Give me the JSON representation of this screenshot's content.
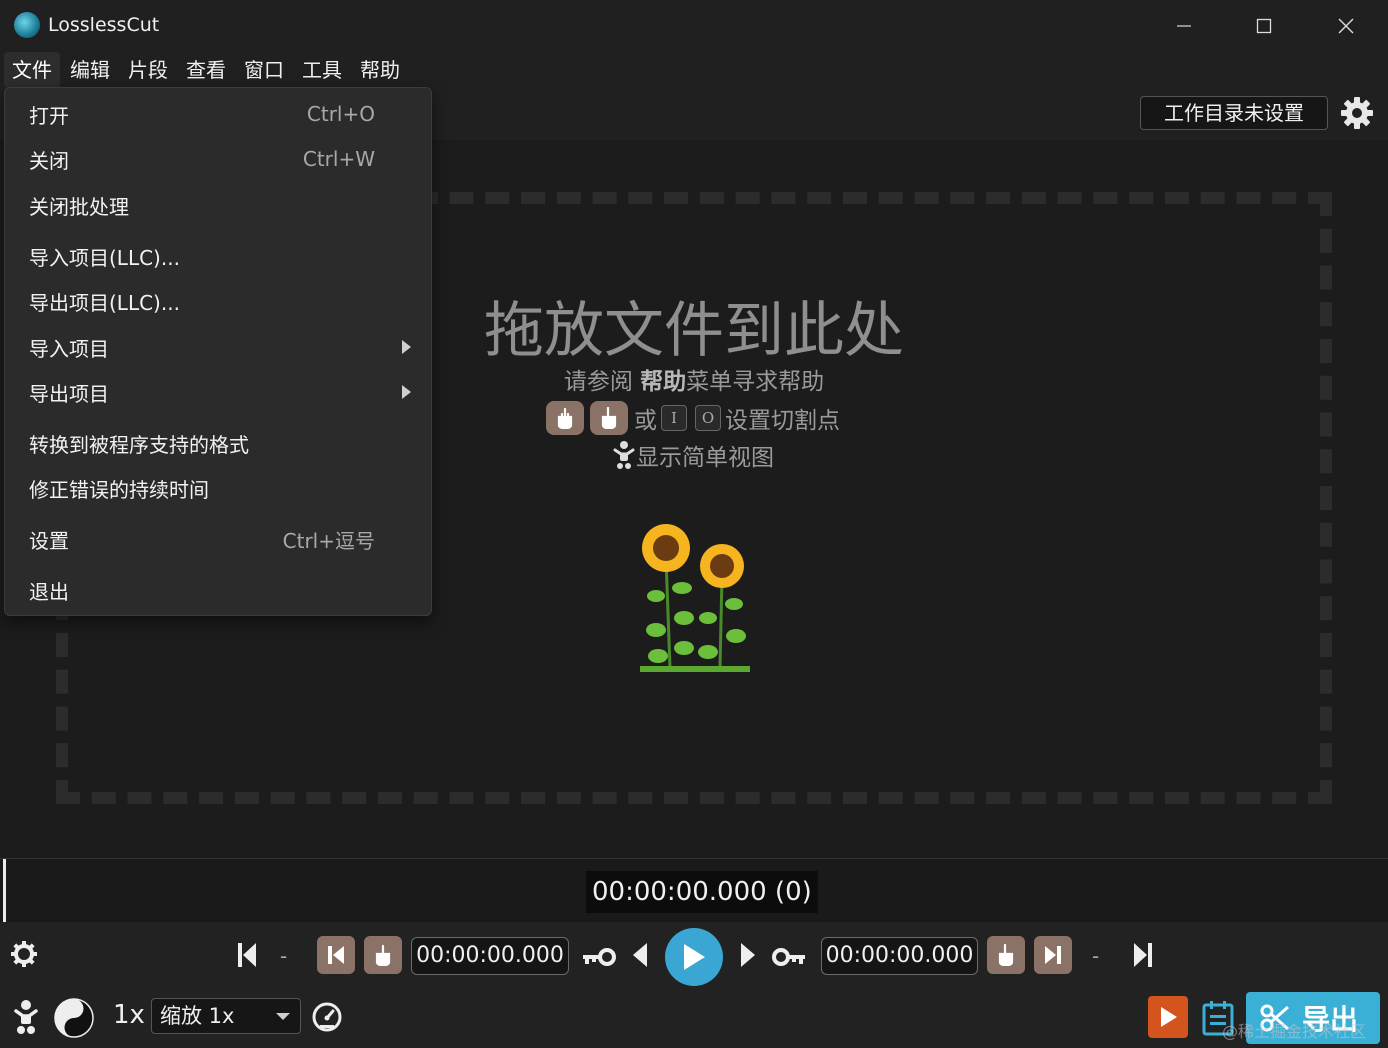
{
  "window": {
    "title": "LosslessCut"
  },
  "menubar": {
    "items": [
      "文件",
      "编辑",
      "片段",
      "查看",
      "窗口",
      "工具",
      "帮助"
    ]
  },
  "file_menu": {
    "items": [
      {
        "label": "打开",
        "shortcut": "Ctrl+O"
      },
      {
        "label": "关闭",
        "shortcut": "Ctrl+W"
      },
      {
        "label": "关闭批处理",
        "shortcut": ""
      },
      {
        "label": "导入项目(LLC)...",
        "shortcut": ""
      },
      {
        "label": "导出项目(LLC)...",
        "shortcut": ""
      },
      {
        "label": "导入项目",
        "shortcut": "",
        "submenu": true
      },
      {
        "label": "导出项目",
        "shortcut": "",
        "submenu": true
      },
      {
        "label": "转换到被程序支持的格式",
        "shortcut": ""
      },
      {
        "label": "修正错误的持续时间",
        "shortcut": ""
      },
      {
        "label": "设置",
        "shortcut": "Ctrl+逗号"
      },
      {
        "label": "退出",
        "shortcut": ""
      }
    ]
  },
  "topbar": {
    "workdir_label": "工作目录未设置"
  },
  "dropzone": {
    "title": "拖放文件到此处",
    "help_prefix": "请参阅 ",
    "help_bold": "帮助",
    "help_suffix": "菜单寻求帮助",
    "or_text": "或",
    "key_in": "I",
    "key_out": "O",
    "cutpoint_text": "设置切割点",
    "simple_view_text": "显示简单视图"
  },
  "timeline": {
    "timecode": "00:00:00.000 (0)"
  },
  "controls": {
    "start_time": "00:00:00.000",
    "end_time": "00:00:00.000",
    "separator": "-",
    "speed": "1x",
    "zoom": "缩放 1x",
    "export_label": "导出",
    "accent_color": "#3aa6d4"
  },
  "watermark": "@稀土掘金技术社区"
}
